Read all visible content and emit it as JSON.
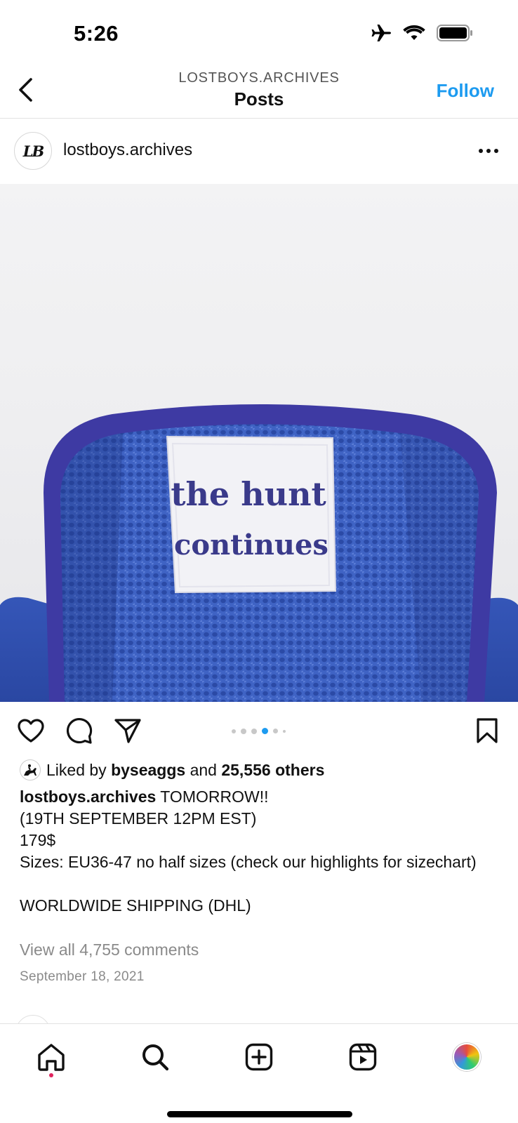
{
  "status_bar": {
    "time": "5:26",
    "icons": [
      "airplane-icon",
      "wifi-icon",
      "battery-icon"
    ]
  },
  "nav": {
    "subtitle": "LOSTBOYS.ARCHIVES",
    "title": "Posts",
    "follow_label": "Follow",
    "accent_color": "#1d9bf0"
  },
  "post": {
    "username": "lostboys.archives",
    "avatar_text": "LB",
    "media": {
      "label_text_line1": "the hunt",
      "label_text_line2": "continues",
      "carousel_count": 6,
      "carousel_active_index": 3
    },
    "likes": {
      "prefix": "Liked by",
      "liker": "byseaggs",
      "connector": "and",
      "others": "25,556 others"
    },
    "caption": {
      "username": "lostboys.archives",
      "line1": "TOMORROW!!",
      "line2": "(19TH SEPTEMBER 12PM EST)",
      "line3": "179$",
      "line4": "Sizes: EU36-47 no half sizes (check our highlights for sizechart)",
      "line5": "WORLDWIDE SHIPPING (DHL)"
    },
    "view_comments": "View all 4,755 comments",
    "date": "September 18, 2021"
  },
  "tabbar": {
    "items": [
      "home-icon",
      "search-icon",
      "create-icon",
      "reels-icon",
      "profile-avatar"
    ],
    "notification_color": "#e0245e"
  }
}
